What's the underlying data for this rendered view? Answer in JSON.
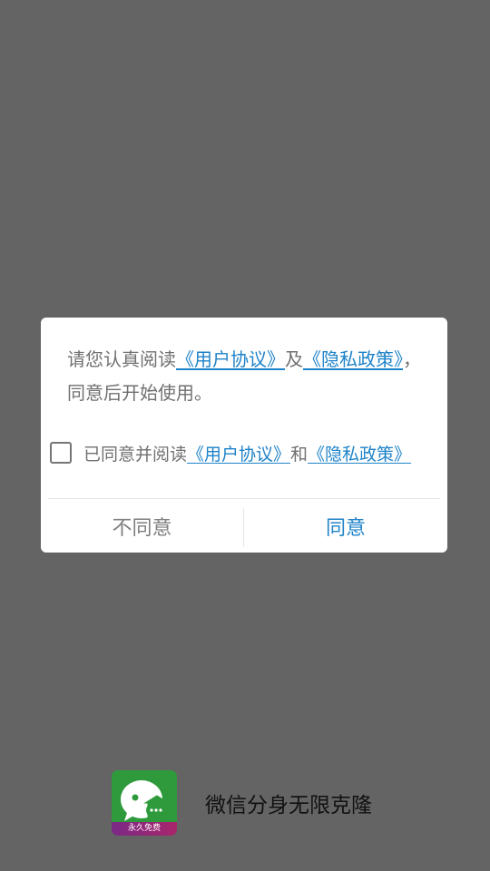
{
  "dialog": {
    "intro": {
      "prefix": "请您认真阅读",
      "link_user": "《用户协议》",
      "middle": "及",
      "link_privacy": "《隐私政策》",
      "suffix": "，同意后开始使用。"
    },
    "consent": {
      "checked": false,
      "prefix": "已同意并阅读",
      "link_user": "《用户协议》",
      "middle": "和",
      "link_privacy": "《隐私政策》"
    },
    "buttons": {
      "disagree": "不同意",
      "agree": "同意"
    }
  },
  "app": {
    "badge_text": "永久免费",
    "name": "微信分身无限克隆"
  },
  "colors": {
    "overlay": "#646464",
    "link": "#1f83c9",
    "icon_green": "#2e9a3c",
    "badge_purple": "#7a2a86"
  }
}
